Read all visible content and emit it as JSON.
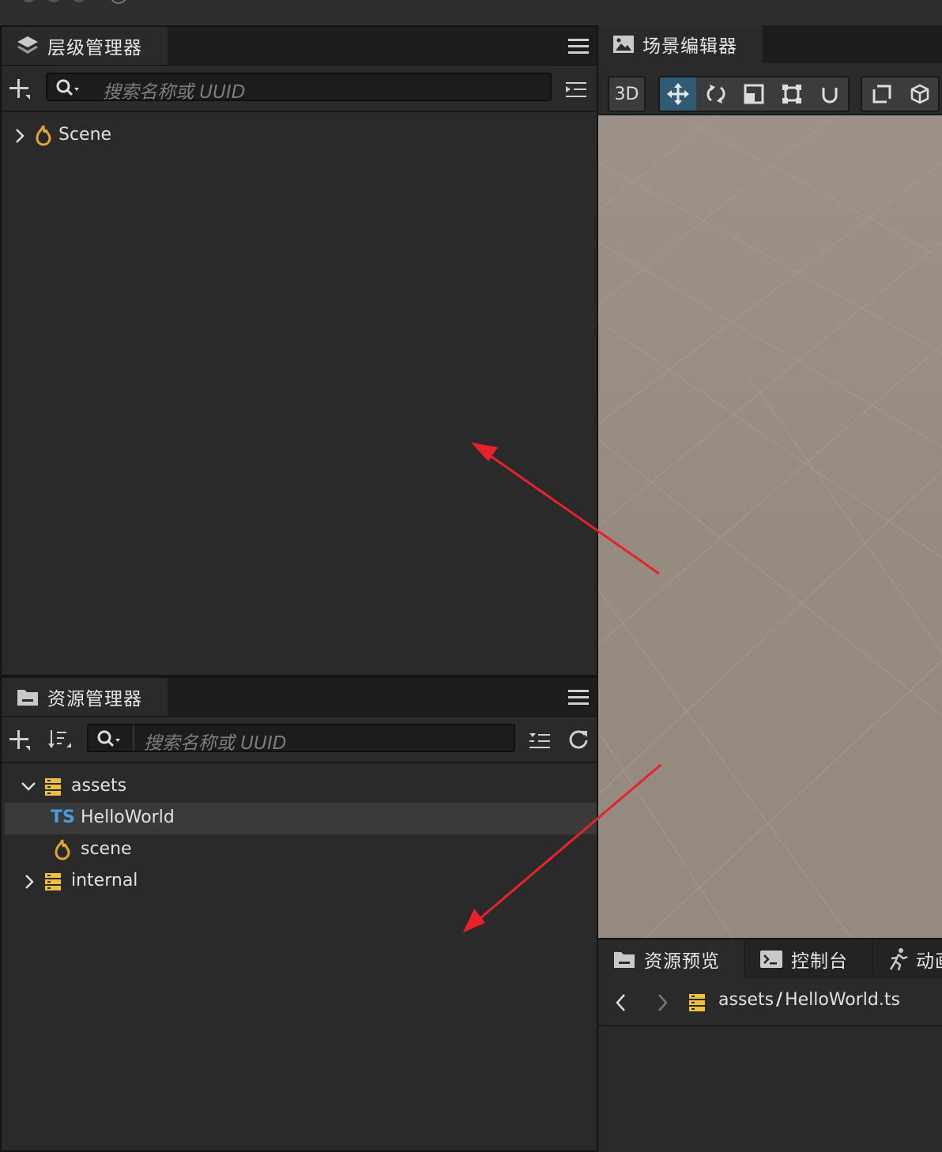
{
  "hierarchy": {
    "title": "层级管理器",
    "search_placeholder": "搜索名称或 UUID",
    "nodes": [
      {
        "label": "Scene"
      }
    ]
  },
  "assets_panel": {
    "title": "资源管理器",
    "search_placeholder": "搜索名称或 UUID",
    "items": [
      {
        "label": "assets",
        "type": "folder",
        "expanded": true
      },
      {
        "label": "HelloWorld",
        "type": "typescript",
        "badge": "TS",
        "selected": true
      },
      {
        "label": "scene",
        "type": "scene"
      },
      {
        "label": "internal",
        "type": "folder",
        "expanded": false
      }
    ]
  },
  "scene_editor": {
    "title": "场景编辑器",
    "toolbar": {
      "mode_3d": "3D",
      "tools": [
        "move-tool",
        "rotate-tool",
        "scale-tool",
        "rect-tool",
        "snap-tool"
      ],
      "active_tool": "move-tool"
    }
  },
  "bottom_tabs": {
    "tabs": [
      "资源预览",
      "控制台",
      "动画"
    ],
    "path_folder": "assets",
    "path_separator": "/",
    "path_file": "HelloWorld.ts"
  },
  "colors": {
    "accent_active": "#2f5b74",
    "folder": "#f0c040",
    "ts": "#4a9be0",
    "scene_icon": "#e3a23a",
    "arrow": "#e8222b",
    "viewport": "#958a80"
  }
}
